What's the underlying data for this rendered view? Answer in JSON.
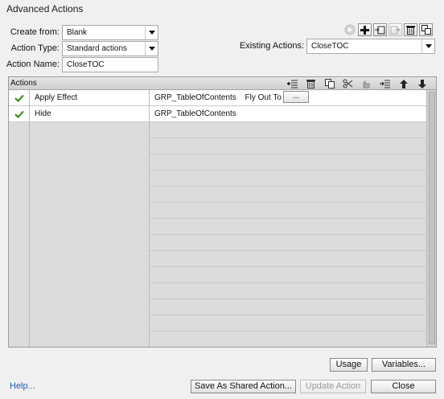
{
  "window": {
    "title": "Advanced Actions"
  },
  "form": {
    "create_from_label": "Create from:",
    "create_from_value": "Blank",
    "action_type_label": "Action Type:",
    "action_type_value": "Standard actions",
    "action_name_label": "Action Name:",
    "action_name_value": "CloseTOC",
    "existing_label": "Existing Actions:",
    "existing_value": "CloseTOC"
  },
  "toolbar_icons": [
    "preview-icon",
    "add-icon",
    "import-icon",
    "export-icon",
    "delete-icon",
    "duplicate-icon"
  ],
  "grid": {
    "header": "Actions",
    "header_icons": [
      "insert-row-icon",
      "delete-row-icon",
      "copy-icon",
      "cut-icon",
      "paste-icon",
      "indent-icon",
      "move-up-icon",
      "move-down-icon"
    ],
    "rows": [
      {
        "checked": true,
        "action": "Apply Effect",
        "target": "GRP_TableOfContents",
        "effect": "Fly Out To Left",
        "more": "..."
      },
      {
        "checked": true,
        "action": "Hide",
        "target": "GRP_TableOfContents"
      }
    ],
    "empty_rows": 14
  },
  "buttons": {
    "usage": "Usage",
    "variables": "Variables...",
    "save_shared": "Save As Shared Action...",
    "update": "Update Action",
    "close": "Close"
  },
  "help": "Help..."
}
